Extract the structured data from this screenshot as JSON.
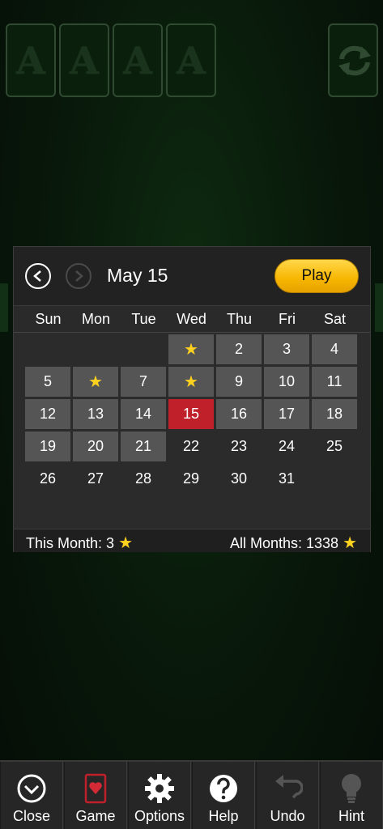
{
  "foundations": [
    "A",
    "A",
    "A",
    "A"
  ],
  "calendar": {
    "month_label": "May 15",
    "play_label": "Play",
    "weekdays": [
      "Sun",
      "Mon",
      "Tue",
      "Wed",
      "Thu",
      "Fri",
      "Sat"
    ],
    "days": [
      {
        "label": "",
        "state": "played",
        "star": true
      },
      {
        "label": "2",
        "state": "played",
        "star": false
      },
      {
        "label": "3",
        "state": "played",
        "star": false
      },
      {
        "label": "4",
        "state": "played",
        "star": false
      },
      {
        "label": "5",
        "state": "played",
        "star": false
      },
      {
        "label": "",
        "state": "played",
        "star": true
      },
      {
        "label": "7",
        "state": "played",
        "star": false
      },
      {
        "label": "",
        "state": "played",
        "star": true
      },
      {
        "label": "9",
        "state": "played",
        "star": false
      },
      {
        "label": "10",
        "state": "played",
        "star": false
      },
      {
        "label": "11",
        "state": "played",
        "star": false
      },
      {
        "label": "12",
        "state": "played",
        "star": false
      },
      {
        "label": "13",
        "state": "played",
        "star": false
      },
      {
        "label": "14",
        "state": "played",
        "star": false
      },
      {
        "label": "15",
        "state": "today",
        "star": false
      },
      {
        "label": "16",
        "state": "played",
        "star": false
      },
      {
        "label": "17",
        "state": "played",
        "star": false
      },
      {
        "label": "18",
        "state": "played",
        "star": false
      },
      {
        "label": "19",
        "state": "played",
        "star": false
      },
      {
        "label": "20",
        "state": "played",
        "star": false
      },
      {
        "label": "21",
        "state": "played",
        "star": false
      },
      {
        "label": "22",
        "state": "future",
        "star": false
      },
      {
        "label": "23",
        "state": "future",
        "star": false
      },
      {
        "label": "24",
        "state": "future",
        "star": false
      },
      {
        "label": "25",
        "state": "future",
        "star": false
      },
      {
        "label": "26",
        "state": "future",
        "star": false
      },
      {
        "label": "27",
        "state": "future",
        "star": false
      },
      {
        "label": "28",
        "state": "future",
        "star": false
      },
      {
        "label": "29",
        "state": "future",
        "star": false
      },
      {
        "label": "30",
        "state": "future",
        "star": false
      },
      {
        "label": "31",
        "state": "future",
        "star": false
      }
    ],
    "footer": {
      "this_month_label": "This Month: 3",
      "all_months_label": "All Months: 1338",
      "star_glyph": "★"
    }
  },
  "toolbar": {
    "close": "Close",
    "game": "Game",
    "options": "Options",
    "help": "Help",
    "undo": "Undo",
    "hint": "Hint"
  },
  "colors": {
    "accent_play": "#f7b500",
    "today": "#c0202a",
    "star": "#ffd21f"
  }
}
